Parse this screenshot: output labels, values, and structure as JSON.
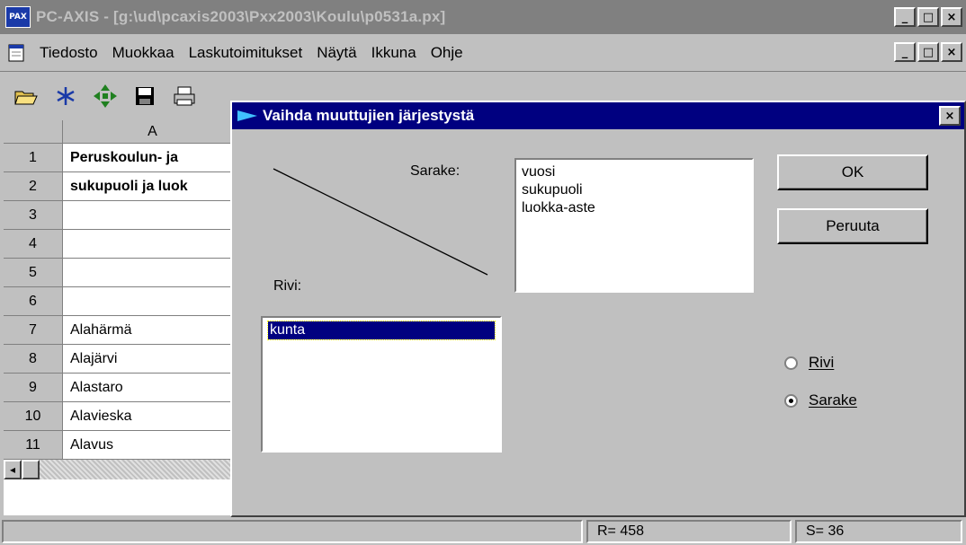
{
  "window": {
    "title": "PC-AXIS - [g:\\ud\\pcaxis2003\\Pxx2003\\Koulu\\p0531a.px]",
    "app_icon_text": "PAX",
    "minimize_glyph": "_",
    "restore_glyph": "□",
    "child_restore_glyph": "ꟹ",
    "close_glyph": "×"
  },
  "menu": {
    "items": [
      "Tiedosto",
      "Muokkaa",
      "Laskutoimitukset",
      "Näytä",
      "Ikkuna",
      "Ohje"
    ]
  },
  "toolbar": {
    "icons": [
      "open-folder-icon",
      "asterisk-icon",
      "move-arrows-icon",
      "save-icon",
      "print-icon"
    ]
  },
  "sheet": {
    "column_header": "A",
    "rows": [
      {
        "num": "1",
        "value": "Peruskoulun- ja"
      },
      {
        "num": "2",
        "value": "sukupuoli ja luok"
      },
      {
        "num": "3",
        "value": ""
      },
      {
        "num": "4",
        "value": ""
      },
      {
        "num": "5",
        "value": ""
      },
      {
        "num": "6",
        "value": ""
      },
      {
        "num": "7",
        "value": "Alahärmä"
      },
      {
        "num": "8",
        "value": "Alajärvi"
      },
      {
        "num": "9",
        "value": "Alastaro"
      },
      {
        "num": "10",
        "value": "Alavieska"
      },
      {
        "num": "11",
        "value": "Alavus"
      }
    ],
    "bold_rows": [
      1,
      2
    ],
    "scroll_left_glyph": "◂"
  },
  "dialog": {
    "title": "Vaihda muuttujien järjestystä",
    "close_glyph": "×",
    "column_label": "Sarake:",
    "row_label": "Rivi:",
    "column_items": [
      "vuosi",
      "sukupuoli",
      "luokka-aste"
    ],
    "row_items": [
      "kunta"
    ],
    "ok_label": "OK",
    "cancel_label": "Peruuta",
    "radio_row_label": "Rivi",
    "radio_column_label": "Sarake",
    "selected_radio": "Sarake"
  },
  "status": {
    "rows": "R= 458",
    "columns": "S= 36"
  },
  "colors": {
    "face": "#c0c0c0",
    "active_title": "#000080",
    "inactive_title": "#808080",
    "selection": "#000080"
  }
}
